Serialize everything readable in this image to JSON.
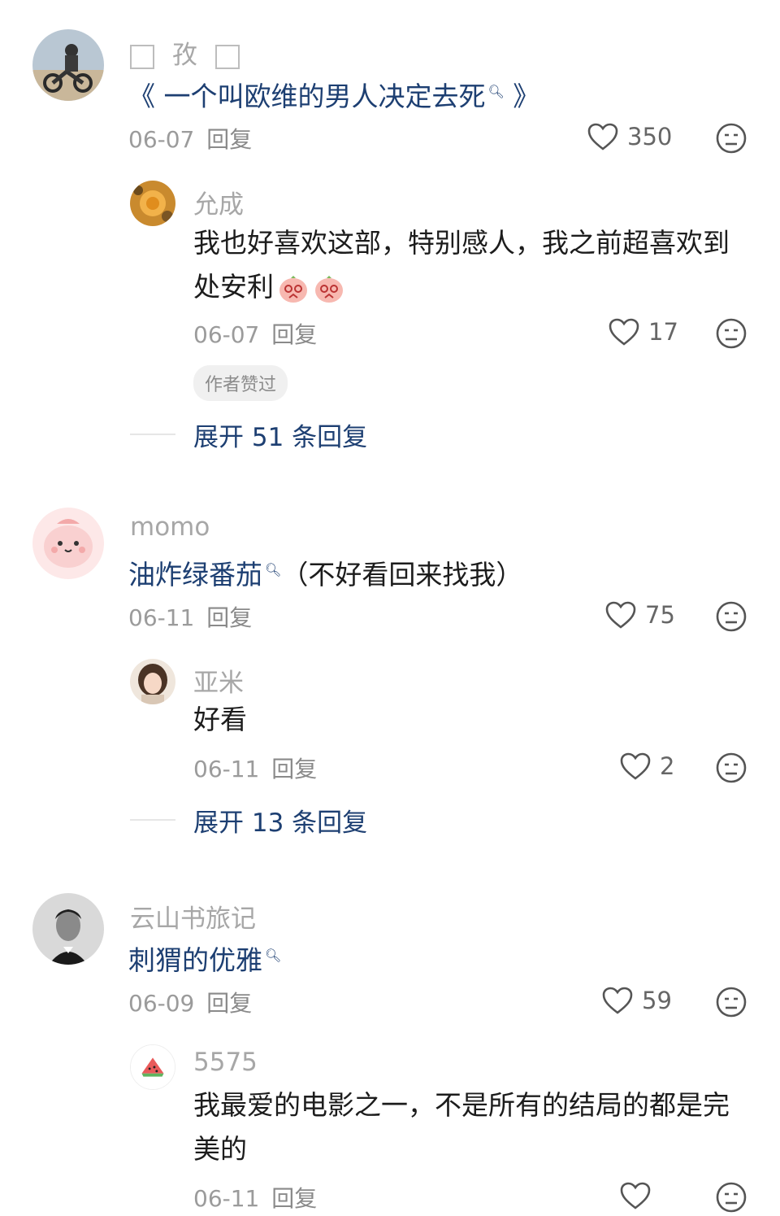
{
  "comments": [
    {
      "name": "孜",
      "text_prefix": "《 ",
      "text": "一个叫欧维的男人决定去死",
      "text_suffix": " 》",
      "date": "06-07",
      "reply": "回复",
      "likes": "350",
      "replies": [
        {
          "name": "允成",
          "line1": "我也好喜欢这部，特别感人，我之前超喜欢到",
          "line2": "处安利",
          "date": "06-07",
          "reply": "回复",
          "likes": "17",
          "badge": "作者赞过"
        }
      ],
      "expand": "展开 51 条回复"
    },
    {
      "name": "momo",
      "text": "油炸绿番茄",
      "text_suffix": "（不好看回来找我）",
      "date": "06-11",
      "reply": "回复",
      "likes": "75",
      "replies": [
        {
          "name": "亚米",
          "line1": "好看",
          "date": "06-11",
          "reply": "回复",
          "likes": "2"
        }
      ],
      "expand": "展开 13 条回复"
    },
    {
      "name": "云山书旅记",
      "text": "刺猬的优雅",
      "date": "06-09",
      "reply": "回复",
      "likes": "59",
      "replies": [
        {
          "name": "5575",
          "line1": "我最爱的电影之一，不是所有的结局的都是完",
          "line2": "美的",
          "date": "06-11",
          "reply": "回复"
        }
      ]
    }
  ],
  "icons": {
    "like": "heart-outline-icon",
    "dislike": "neutral-face-icon",
    "search_mark": "search-icon",
    "emoji": "crying-peach-emoji"
  },
  "colors": {
    "link": "#1d3f72",
    "name": "#a7a7a7",
    "meta": "#9b9b9b"
  }
}
